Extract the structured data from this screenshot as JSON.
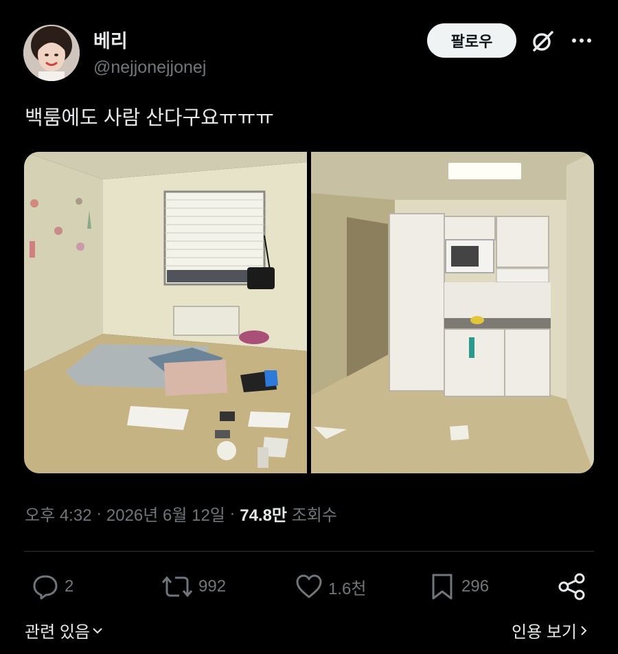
{
  "author": {
    "name": "베리",
    "handle": "@nejjonejjonej"
  },
  "header": {
    "follow_label": "팔로우",
    "grok_icon": "grok-icon",
    "more_icon": "more-icon"
  },
  "tweet": {
    "text": "백룸에도 사람 산다구요ㅠㅠㅠ",
    "time": "오후 4:32",
    "date": "2026년 6월 12일",
    "views": "74.8만",
    "views_label": "조회수"
  },
  "actions": {
    "replies": "2",
    "reposts": "992",
    "likes": "1.6천",
    "bookmarks": "296"
  },
  "footer": {
    "related": "관련 있음",
    "view_quotes": "인용 보기"
  },
  "colors": {
    "background": "#000000",
    "text": "#e7e9ea",
    "secondary": "#71767b",
    "follow_bg": "#eff3f4"
  }
}
